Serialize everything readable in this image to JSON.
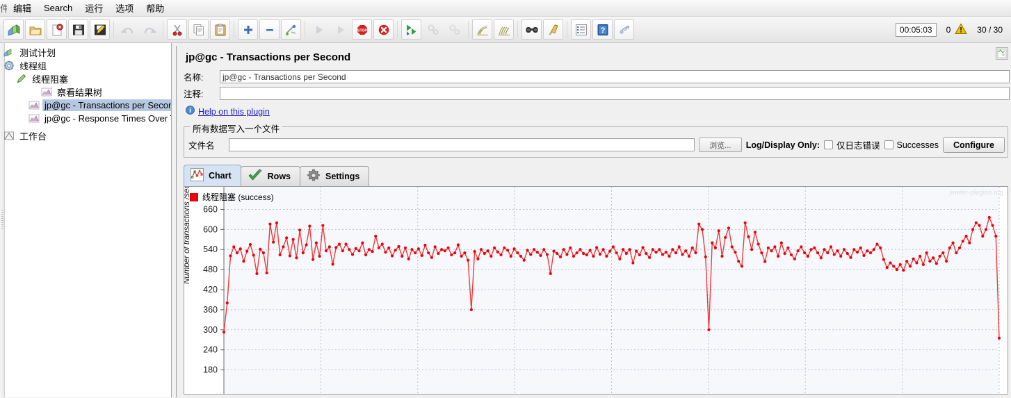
{
  "menu": {
    "items": [
      {
        "label": "件",
        "clipped": true
      },
      {
        "label": "编辑"
      },
      {
        "label": "Search"
      },
      {
        "label": "运行"
      },
      {
        "label": "选项"
      },
      {
        "label": "帮助"
      }
    ]
  },
  "toolbar": {
    "buttons": [
      {
        "name": "new-test-plan-icon",
        "label": "新建"
      },
      {
        "name": "open-icon",
        "label": "打开"
      },
      {
        "name": "close-icon",
        "label": "关闭"
      },
      {
        "name": "save-icon",
        "label": "保存"
      },
      {
        "name": "save-as-icon",
        "label": "另存为"
      },
      {
        "name": "undo-icon",
        "label": "撤销"
      },
      {
        "name": "redo-icon",
        "label": "重做"
      },
      {
        "name": "cut-icon",
        "label": "剪切"
      },
      {
        "name": "copy-icon",
        "label": "复制"
      },
      {
        "name": "paste-icon",
        "label": "粘贴"
      },
      {
        "name": "expand-all-icon",
        "label": "展开全部"
      },
      {
        "name": "collapse-all-icon",
        "label": "折叠全部"
      },
      {
        "name": "toggle-icon",
        "label": "切换"
      },
      {
        "name": "start-icon",
        "label": "启动"
      },
      {
        "name": "start-no-pause-icon",
        "label": "无暂停启动"
      },
      {
        "name": "stop-icon",
        "label": "停止"
      },
      {
        "name": "shutdown-icon",
        "label": "关闭"
      },
      {
        "name": "start-remote-all-icon",
        "label": "远程全部启动"
      },
      {
        "name": "stop-remote-all-icon",
        "label": "远程全部停止"
      },
      {
        "name": "shutdown-remote-all-icon",
        "label": "远程全部关闭"
      },
      {
        "name": "clear-icon",
        "label": "清除"
      },
      {
        "name": "clear-all-icon",
        "label": "清除全部"
      },
      {
        "name": "search-icon",
        "label": "查找"
      },
      {
        "name": "search-reset-icon",
        "label": "重置查找"
      },
      {
        "name": "function-helper-icon",
        "label": "函数助手"
      },
      {
        "name": "help-icon",
        "label": "帮助"
      },
      {
        "name": "templates-icon",
        "label": "模板"
      }
    ],
    "elapsed_time": "00:05:03",
    "error_count": "0",
    "thread_count": "30 / 30"
  },
  "tree": {
    "nodes": [
      {
        "label": "测试计划",
        "icon": "test-plan-icon",
        "indent": 1,
        "selected": false
      },
      {
        "label": "线程组",
        "icon": "thread-group-icon",
        "indent": 1,
        "selected": false
      },
      {
        "label": "线程阻塞",
        "icon": "sampler-icon",
        "indent": 2,
        "selected": false
      },
      {
        "label": "察看结果树",
        "icon": "listener-icon",
        "indent": 4,
        "selected": false
      },
      {
        "label": "jp@gc - Transactions per Second",
        "icon": "listener-icon",
        "indent": 3,
        "selected": true
      },
      {
        "label": "jp@gc - Response Times Over Tim",
        "icon": "listener-icon",
        "indent": 3,
        "selected": false
      },
      {
        "label": "工作台",
        "icon": "workbench-icon",
        "indent": 1,
        "selected": false
      }
    ]
  },
  "panel": {
    "title": "jp@gc - Transactions per Second",
    "name_label": "名称:",
    "name_value": "jp@gc - Transactions per Second",
    "comment_label": "注释:",
    "comment_value": "",
    "help_link": "Help on this plugin",
    "group_title": "所有数据写入一个文件",
    "filename_label": "文件名",
    "filename_value": "",
    "filename_placeholder": "",
    "browse_label": "浏览...",
    "log_display_only_label": "Log/Display Only:",
    "errors_only_label": "仅日志错误",
    "errors_only_checked": false,
    "successes_label": "Successes",
    "successes_checked": false,
    "configure_label": "Configure",
    "expand_icon_name": "maximize-chart-icon"
  },
  "tabs": [
    {
      "label": "Chart",
      "icon": "chart-icon",
      "active": true
    },
    {
      "label": "Rows",
      "icon": "check-icon",
      "active": false
    },
    {
      "label": "Settings",
      "icon": "gear-icon",
      "active": false
    }
  ],
  "chart_data": {
    "type": "line",
    "title": "",
    "watermark": "jmeter-plugins.org",
    "legend": [
      {
        "name": "线程阻塞 (success)",
        "color": "#e8030e"
      }
    ],
    "legend_position": "top-left",
    "xlabel": "",
    "ylabel": "Number of transactions /sec",
    "yticks": [
      660,
      600,
      540,
      480,
      420,
      360,
      300,
      240,
      180
    ],
    "ylim": [
      150,
      690
    ],
    "grid": true,
    "marker": "circle",
    "marker_color": "#e8030e",
    "line_color": "#ee3b3b",
    "series": [
      {
        "name": "线程阻塞 (success)",
        "values": [
          293,
          380,
          521,
          548,
          530,
          542,
          505,
          535,
          555,
          523,
          468,
          541,
          530,
          470,
          616,
          562,
          620,
          524,
          548,
          575,
          521,
          570,
          515,
          598,
          530,
          554,
          610,
          510,
          560,
          520,
          612,
          536,
          548,
          496,
          546,
          556,
          536,
          556,
          540,
          525,
          543,
          536,
          560,
          524,
          540,
          534,
          580,
          545,
          556,
          532,
          545,
          521,
          538,
          549,
          520,
          545,
          512,
          540,
          530,
          542,
          522,
          553,
          530,
          516,
          548,
          528,
          540,
          536,
          545,
          524,
          530,
          554,
          520,
          530,
          508,
          360,
          534,
          512,
          540,
          528,
          536,
          520,
          545,
          533,
          524,
          545,
          538,
          520,
          542,
          530,
          520,
          508,
          538,
          525,
          540,
          532,
          522,
          540,
          525,
          468,
          535,
          528,
          518,
          540,
          525,
          545,
          520,
          530,
          540,
          528,
          524,
          538,
          520,
          546,
          526,
          540,
          520,
          535,
          548,
          530,
          512,
          540,
          528,
          540,
          500,
          535,
          524,
          546,
          528,
          516,
          540,
          532,
          540,
          525,
          532,
          520,
          540,
          530,
          548,
          525,
          536,
          520,
          545,
          530,
          616,
          600,
          518,
          300,
          560,
          545,
          596,
          520,
          576,
          604,
          548,
          532,
          505,
          490,
          620,
          578,
          540,
          592,
          556,
          530,
          504,
          545,
          536,
          548,
          520,
          560,
          528,
          545,
          524,
          512,
          536,
          548,
          530,
          520,
          540,
          545,
          530,
          515,
          540,
          530,
          548,
          525,
          536,
          520,
          540,
          528,
          516,
          540,
          532,
          545,
          522,
          536,
          530,
          540,
          556,
          545,
          510,
          486,
          500,
          490,
          480,
          495,
          478,
          505,
          490,
          512,
          500,
          520,
          495,
          530,
          505,
          515,
          498,
          520,
          530,
          505,
          545,
          560,
          530,
          545,
          565,
          580,
          560,
          600,
          620,
          612,
          580,
          600,
          636,
          612,
          580,
          275
        ]
      }
    ]
  }
}
